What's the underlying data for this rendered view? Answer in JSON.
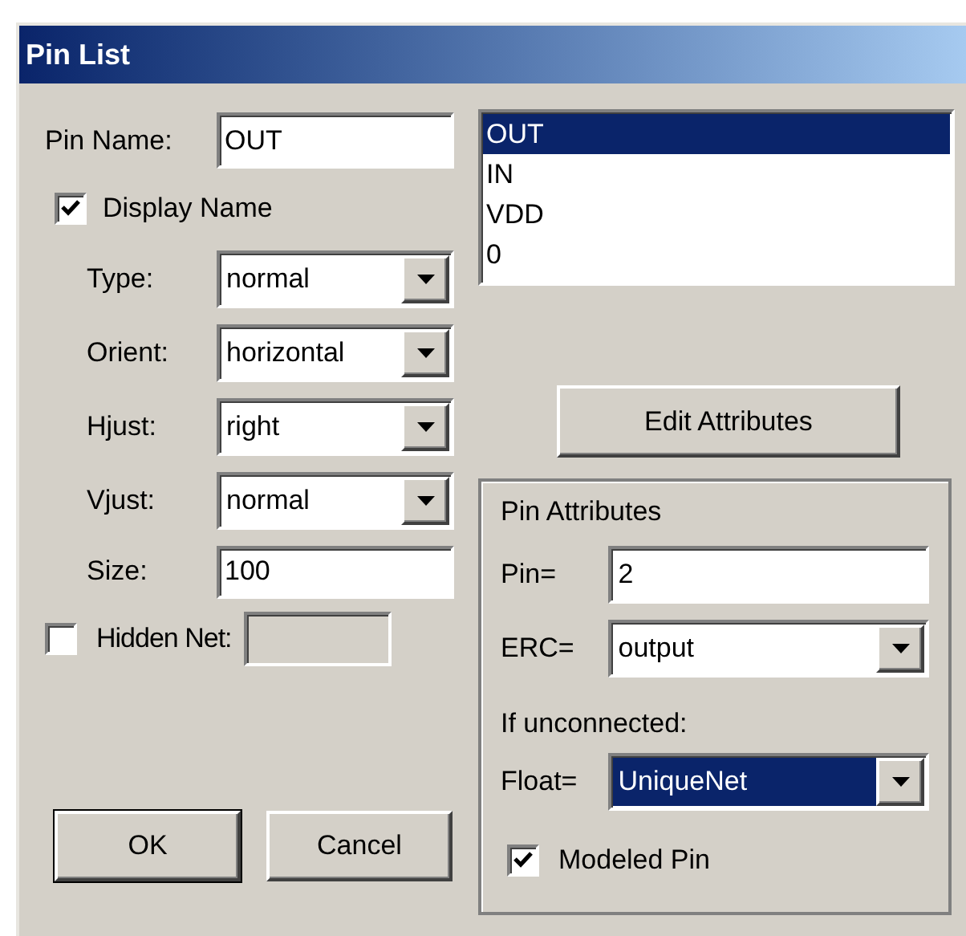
{
  "window": {
    "title": "Pin List"
  },
  "pin_name": {
    "label": "Pin Name:",
    "value": "OUT"
  },
  "display_name": {
    "label": "Display Name",
    "checked": true
  },
  "dropdowns": [
    {
      "label": "Type:",
      "value": "normal"
    },
    {
      "label": "Orient:",
      "value": "horizontal"
    },
    {
      "label": "Hjust:",
      "value": "right"
    },
    {
      "label": "Vjust:",
      "value": "normal"
    }
  ],
  "size": {
    "label": "Size:",
    "value": "100"
  },
  "hidden_net": {
    "label": "Hidden Net:",
    "checked": false
  },
  "pins": [
    {
      "name": "OUT",
      "selected": true
    },
    {
      "name": "IN",
      "selected": false
    },
    {
      "name": "VDD",
      "selected": false
    },
    {
      "name": "0",
      "selected": false
    }
  ],
  "edit_button": "Edit Attributes",
  "pin_attributes": {
    "title": "Pin Attributes",
    "pin": {
      "label": "Pin=",
      "value": "2"
    },
    "erc": {
      "label": "ERC=",
      "value": "output"
    },
    "unconnected_label": "If unconnected:",
    "float": {
      "label": "Float=",
      "value": "UniqueNet",
      "focused": true
    },
    "modeled_pin": {
      "label": "Modeled Pin",
      "checked": true
    }
  },
  "buttons": [
    {
      "label": "OK",
      "default": true
    },
    {
      "label": "Cancel",
      "default": false
    }
  ]
}
